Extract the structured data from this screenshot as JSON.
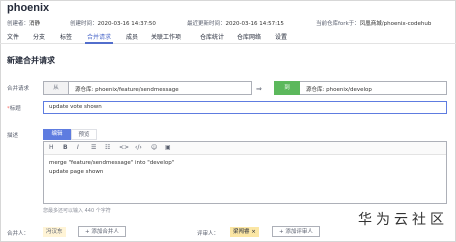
{
  "repo": {
    "title": "phoenix"
  },
  "meta": {
    "creator_label": "创建者：",
    "creator": "消静",
    "created_label": "创建时间：",
    "created": "2020-03-16 14:37:50",
    "updated_label": "最近更新时间：",
    "updated": "2020-03-16 14:57:15",
    "fork_label": "当前仓库fork于：",
    "fork_source": "凤凰商城/phoenix-codehub"
  },
  "tabs": [
    {
      "label": "文件"
    },
    {
      "label": "分支"
    },
    {
      "label": "标签"
    },
    {
      "label": "合并请求"
    },
    {
      "label": "成员"
    },
    {
      "label": "关联工作项"
    },
    {
      "label": "仓库统计"
    },
    {
      "label": "仓库网络"
    },
    {
      "label": "设置"
    }
  ],
  "active_tab": "合并请求",
  "form": {
    "section_title": "新建合并请求",
    "merge_label": "合并请求",
    "from_tag": "从",
    "source_text": "源仓库: phoenix/feature/sendmessage",
    "arrow": "⇒",
    "to_tag": "到",
    "target_text": "源仓库: phoenix/develop",
    "title_label": "标题",
    "required_mark": "*",
    "title_value": "update vote shown",
    "desc_label": "描述",
    "editor_tabs": [
      "编辑",
      "预览"
    ],
    "toolbar": [
      "H",
      "B",
      "I",
      "☰",
      "☷",
      "<>",
      "‹/›",
      "☺",
      "▣"
    ],
    "editor_lines": [
      "merge \"feature/sendmessage\" into \"develop\"",
      "update page shown"
    ],
    "char_hint": "您最多还可以输入 440 个字符",
    "assignee_label": "合并人：",
    "assignee": "冯汉东",
    "add_assignee": "+ 添加合并人",
    "reviewer_label": "评审人：",
    "reviewer": "梁闯睿 ×",
    "add_reviewer": "+ 添加评审人"
  },
  "watermark": "华为云社区",
  "colors": {
    "accent": "#5e7ce0",
    "target_tag": "#5cb85c",
    "required": "#f66f6a"
  }
}
